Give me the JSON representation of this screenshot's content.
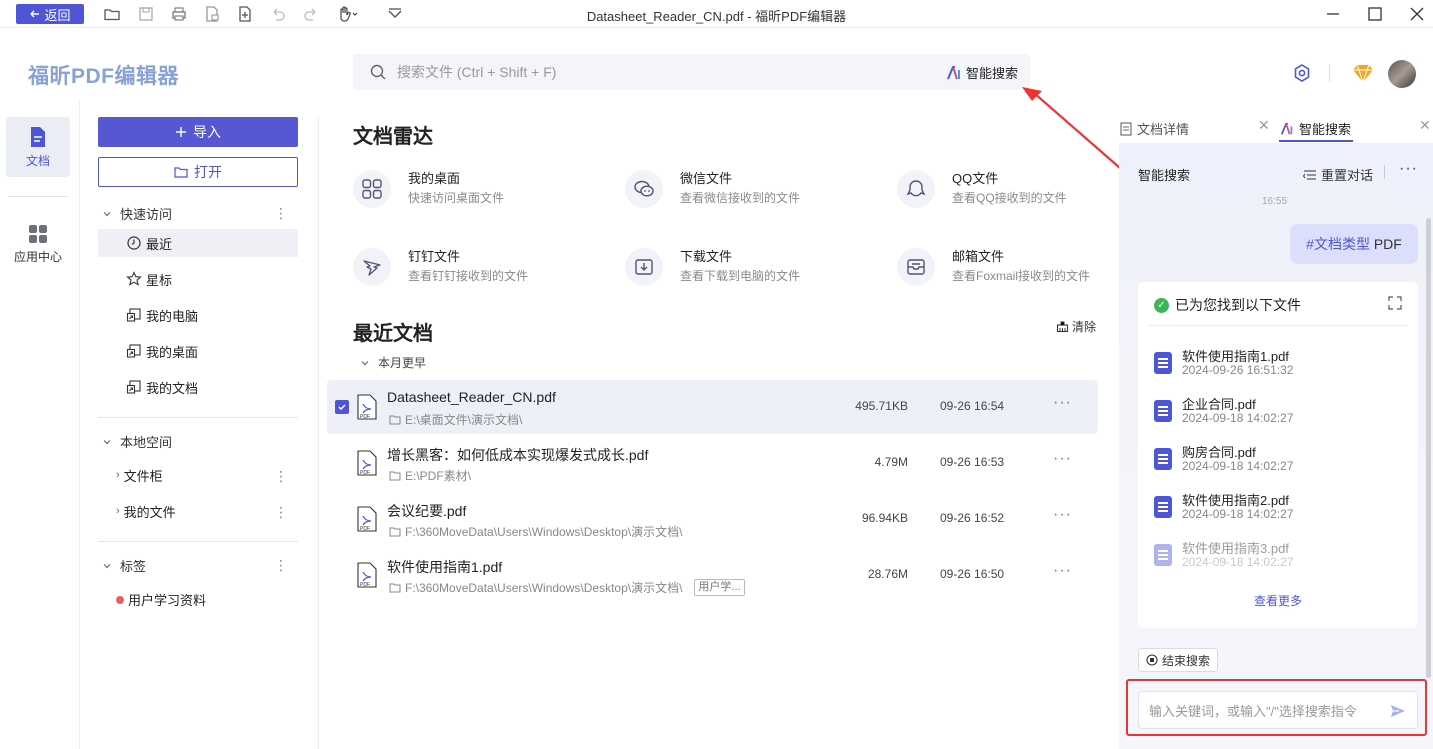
{
  "titlebar": {
    "back_label": "返回",
    "window_title": "Datasheet_Reader_CN.pdf - 福昕PDF编辑器",
    "toolbar_icons": [
      "open-folder-icon",
      "save-icon",
      "print-icon",
      "export-icon",
      "new-file-icon",
      "undo-icon",
      "redo-icon",
      "hand-tool-icon",
      "dropdown-icon"
    ],
    "window_controls": [
      "minimize-icon",
      "maximize-icon",
      "close-icon"
    ]
  },
  "header": {
    "app_name": "福昕PDF编辑器",
    "search_placeholder": "搜索文件 (Ctrl + Shift + F)",
    "ai_search_label": "智能搜索"
  },
  "rail": {
    "items": [
      {
        "label": "文档",
        "icon": "document-icon",
        "active": true
      },
      {
        "label": "应用中心",
        "icon": "apps-icon",
        "active": false
      }
    ]
  },
  "nav": {
    "import_label": "导入",
    "open_label": "打开",
    "quick_access": {
      "title": "快速访问",
      "items": [
        {
          "label": "最近",
          "icon": "clock-icon",
          "active": true
        },
        {
          "label": "星标",
          "icon": "star-icon"
        },
        {
          "label": "我的电脑",
          "icon": "shortcut-icon"
        },
        {
          "label": "我的桌面",
          "icon": "shortcut-icon"
        },
        {
          "label": "我的文档",
          "icon": "shortcut-icon"
        }
      ]
    },
    "local_space": {
      "title": "本地空间",
      "items": [
        {
          "label": "文件柜"
        },
        {
          "label": "我的文件"
        }
      ]
    },
    "tags": {
      "title": "标签",
      "items": [
        {
          "label": "用户学习资料",
          "color": "#ef5b5b"
        }
      ]
    }
  },
  "radar": {
    "title": "文档雷达",
    "items": [
      {
        "title": "我的桌面",
        "sub": "快速访问桌面文件",
        "icon": "grid-icon"
      },
      {
        "title": "微信文件",
        "sub": "查看微信接收到的文件",
        "icon": "wechat-icon"
      },
      {
        "title": "QQ文件",
        "sub": "查看QQ接收到的文件",
        "icon": "qq-icon"
      },
      {
        "title": "钉钉文件",
        "sub": "查看钉钉接收到的文件",
        "icon": "dingtalk-icon"
      },
      {
        "title": "下载文件",
        "sub": "查看下载到电脑的文件",
        "icon": "download-icon"
      },
      {
        "title": "邮箱文件",
        "sub": "查看Foxmail接收到的文件",
        "icon": "mail-icon"
      }
    ]
  },
  "recent": {
    "title": "最近文档",
    "clear_label": "清除",
    "group_label": "本月更早",
    "files": [
      {
        "name": "Datasheet_Reader_CN.pdf",
        "path": "E:\\桌面文件\\演示文档\\",
        "size": "495.71KB",
        "time": "09-26 16:54",
        "selected": true,
        "tag": ""
      },
      {
        "name": "增长黑客：如何低成本实现爆发式成长.pdf",
        "path": "E:\\PDF素材\\",
        "size": "4.79M",
        "time": "09-26 16:53",
        "selected": false,
        "tag": ""
      },
      {
        "name": "会议纪要.pdf",
        "path": "F:\\360MoveData\\Users\\Windows\\Desktop\\演示文档\\",
        "size": "96.94KB",
        "time": "09-26 16:52",
        "selected": false,
        "tag": ""
      },
      {
        "name": "软件使用指南1.pdf",
        "path": "F:\\360MoveData\\Users\\Windows\\Desktop\\演示文档\\",
        "size": "28.76M",
        "time": "09-26 16:50",
        "selected": false,
        "tag": "用户学..."
      }
    ]
  },
  "right_panel": {
    "tabs": [
      {
        "label": "文档详情",
        "icon": "doc-details-icon",
        "active": false
      },
      {
        "label": "智能搜索",
        "icon": "ai-icon",
        "active": true
      }
    ],
    "title": "智能搜索",
    "reset_label": "重置对话",
    "timestamp": "16:55",
    "query_hash": "#文档类型",
    "query_text": " PDF",
    "result_title": "已为您找到以下文件",
    "results": [
      {
        "name": "软件使用指南1.pdf",
        "date": "2024-09-26 16:51:32"
      },
      {
        "name": "企业合同.pdf",
        "date": "2024-09-18 14:02:27"
      },
      {
        "name": "购房合同.pdf",
        "date": "2024-09-18 14:02:27"
      },
      {
        "name": "软件使用指南2.pdf",
        "date": "2024-09-18 14:02:27"
      },
      {
        "name": "软件使用指南3.pdf",
        "date": "2024-09-18 14:02:27"
      }
    ],
    "view_more_label": "查看更多",
    "end_search_label": "结束搜索",
    "input_placeholder": "输入关键词，或输入\"/\"选择搜索指令"
  },
  "colors": {
    "accent": "#4f56d6",
    "highlight_red": "#ee3333",
    "tag_red": "#ef5b5b",
    "success_green": "#3cb55a"
  }
}
